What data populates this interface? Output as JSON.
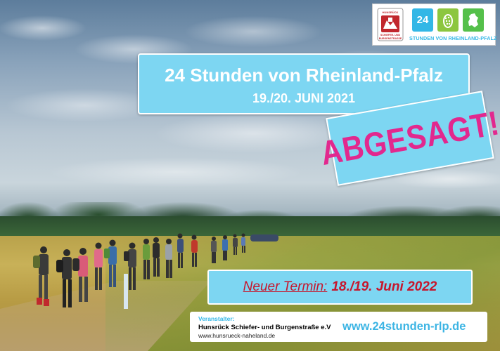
{
  "logo": {
    "badge_lines": [
      "HUNSRÜCK",
      "SCHIEFER- UND",
      "BURGENSTRASSE"
    ],
    "tile_number": "24",
    "caption": "STUNDEN VON RHEINLAND-PFALZ",
    "colors": {
      "blue": "#33b7e6",
      "green": "#8cc63f",
      "dark_green": "#55c04a",
      "badge_red": "#c1272d"
    }
  },
  "title": {
    "main": "24 Stunden von Rheinland-Pfalz",
    "date": "19./20. JUNI 2021"
  },
  "cancel": {
    "text": "ABGESAGT!",
    "color": "#e2288e"
  },
  "new_date": {
    "label": "Neuer Termin:",
    "value": "18./19. Juni 2022",
    "color": "#c7162c"
  },
  "organizer": {
    "label": "Veranstalter:",
    "name": "Hunsrück Schiefer- und Burgenstraße e.V",
    "url": "www.hunsrueck-naheland.de",
    "site": "www.24stunden-rlp.de"
  },
  "banner_color": "#7dd6f2"
}
